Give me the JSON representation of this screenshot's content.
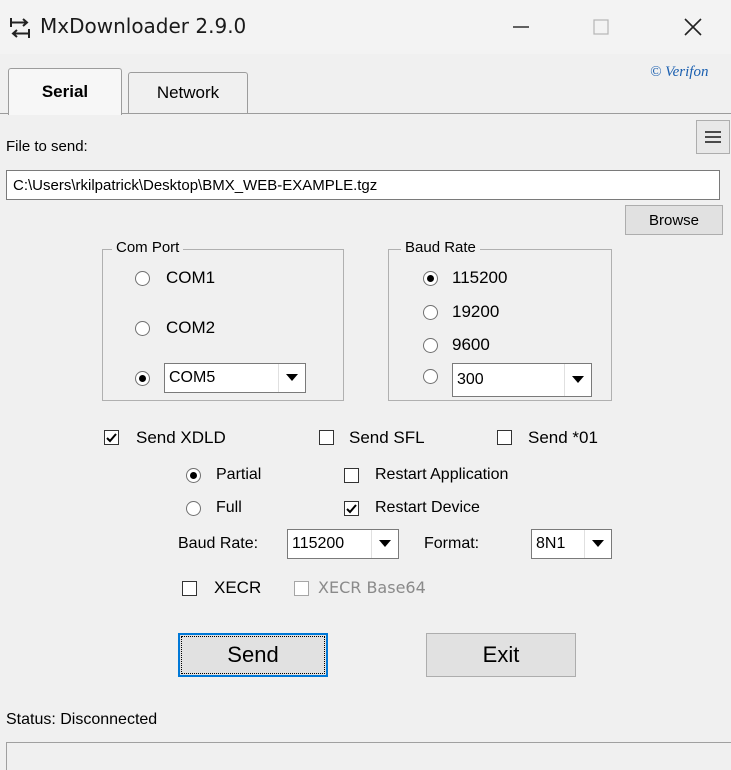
{
  "window": {
    "title": "MxDownloader 2.9.0",
    "icon": "transfer-arrows-icon",
    "controls": {
      "minimize": "minimize-icon",
      "maximize": "maximize-icon",
      "close": "close-icon"
    }
  },
  "tabs": [
    {
      "label": "Serial",
      "active": true
    },
    {
      "label": "Network",
      "active": false
    }
  ],
  "copyright": "© Verifon",
  "file": {
    "label": "File to send:",
    "value": "C:\\Users\\rkilpatrick\\Desktop\\BMX_WEB-EXAMPLE.tgz",
    "browse_label": "Browse",
    "menu_icon": "hamburger-menu-icon"
  },
  "com_port": {
    "title": "Com Port",
    "options": [
      "COM1",
      "COM2"
    ],
    "selected_value": "COM5"
  },
  "baud_rate_group": {
    "title": "Baud Rate",
    "options": [
      "115200",
      "19200",
      "9600"
    ],
    "selected": "115200",
    "custom_value": "300"
  },
  "send_options": {
    "send_xdld": {
      "label": "Send XDLD",
      "checked": true
    },
    "send_sfl": {
      "label": "Send SFL",
      "checked": false
    },
    "send_01": {
      "label": "Send *01",
      "checked": false
    }
  },
  "xdld": {
    "partial": {
      "label": "Partial",
      "selected": true
    },
    "full": {
      "label": "Full",
      "selected": false
    },
    "restart_app": {
      "label": "Restart Application",
      "checked": false
    },
    "restart_device": {
      "label": "Restart Device",
      "checked": true
    },
    "baud_label": "Baud Rate:",
    "baud_value": "115200",
    "format_label": "Format:",
    "format_value": "8N1",
    "xecr": {
      "label": "XECR",
      "checked": false
    },
    "xecr_base64": {
      "label": "XECR Base64",
      "checked": false,
      "disabled": true
    }
  },
  "buttons": {
    "send": "Send",
    "exit": "Exit"
  },
  "status": {
    "text": "Status: Disconnected"
  }
}
